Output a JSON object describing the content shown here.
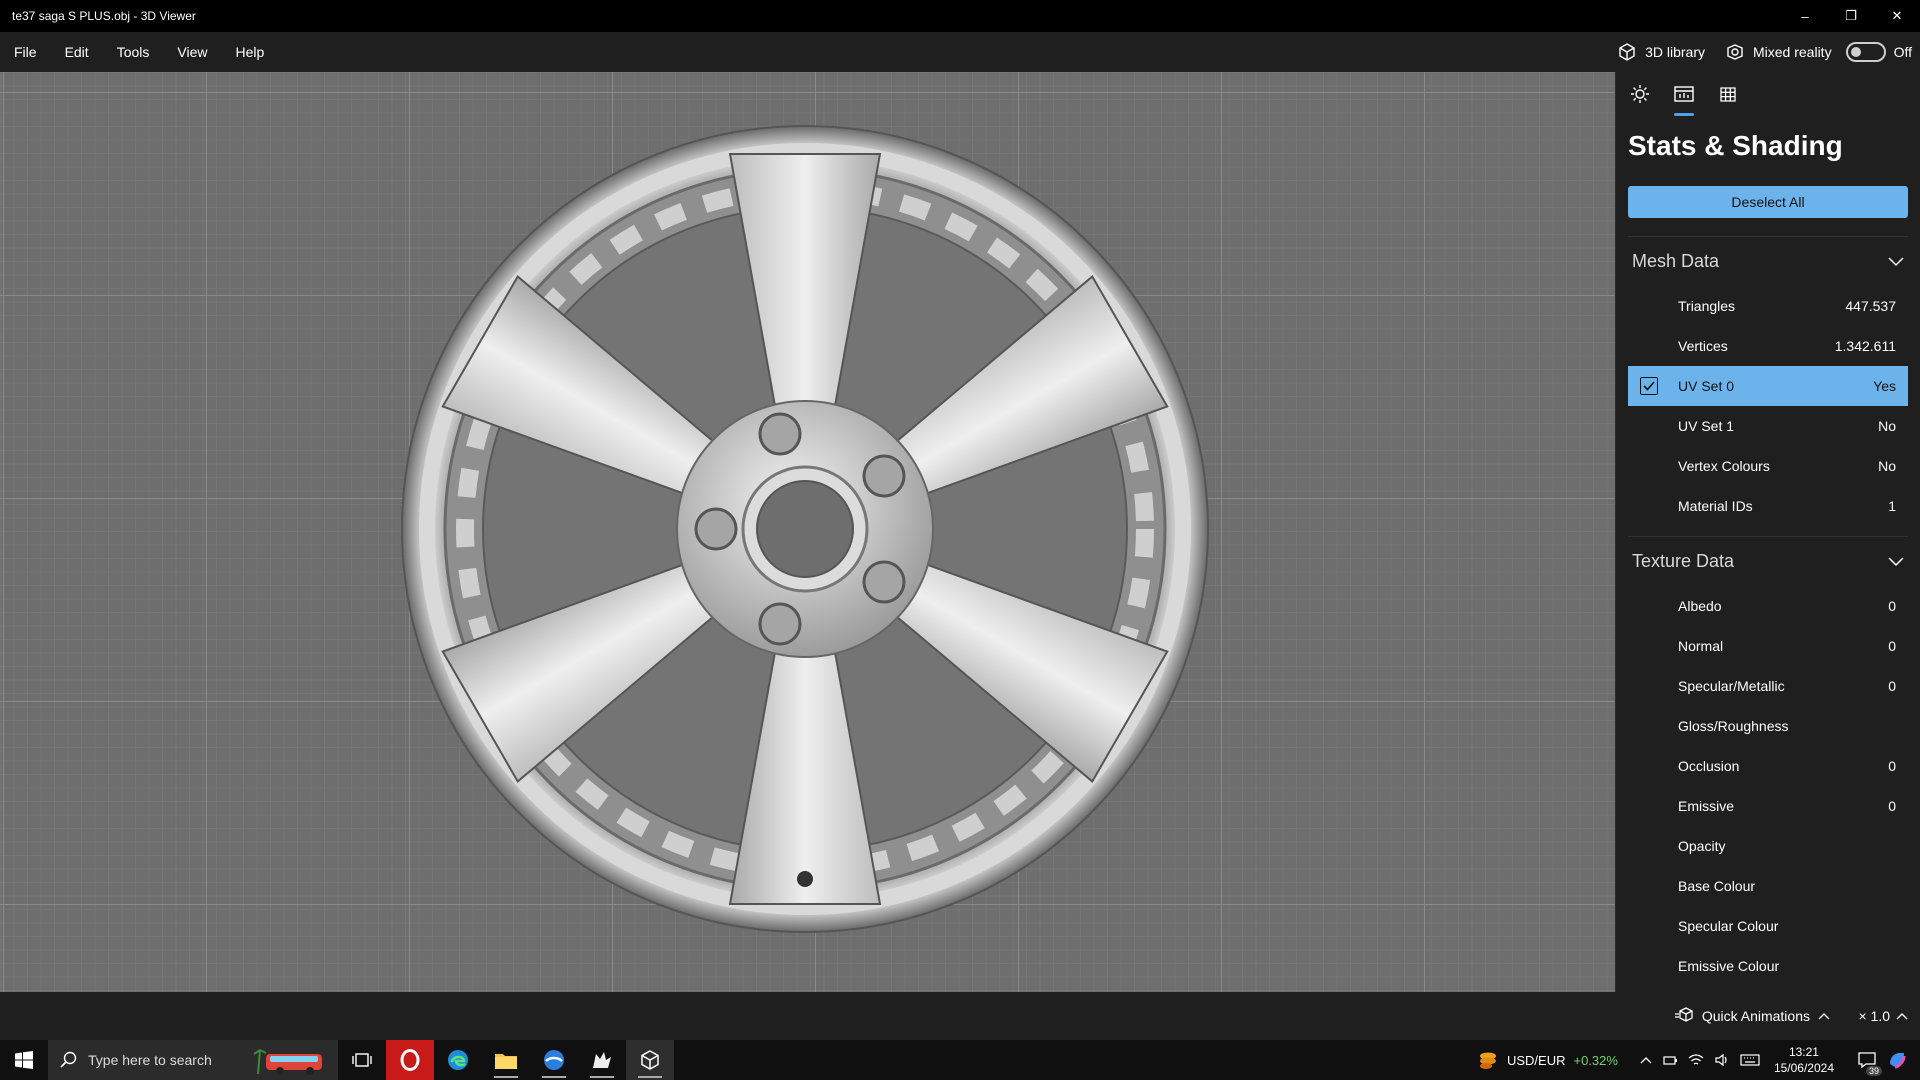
{
  "window": {
    "title": "te37 saga S PLUS.obj - 3D Viewer",
    "minimize": "–",
    "restore": "❐",
    "close": "✕"
  },
  "menu": {
    "items": [
      "File",
      "Edit",
      "Tools",
      "View",
      "Help"
    ],
    "library_label": "3D library",
    "mixed_reality_label": "Mixed reality",
    "mixed_reality_state": "Off"
  },
  "panel": {
    "tab_icons": [
      "sun-icon",
      "stats-icon",
      "grid-icon"
    ],
    "title": "Stats & Shading",
    "deselect_label": "Deselect All",
    "mesh": {
      "title": "Mesh Data",
      "rows": [
        {
          "label": "Triangles",
          "value": "447.537"
        },
        {
          "label": "Vertices",
          "value": "1.342.611"
        },
        {
          "label": "UV Set 0",
          "value": "Yes"
        },
        {
          "label": "UV Set 1",
          "value": "No"
        },
        {
          "label": "Vertex Colours",
          "value": "No"
        },
        {
          "label": "Material IDs",
          "value": "1"
        }
      ]
    },
    "texture": {
      "title": "Texture Data",
      "rows": [
        {
          "label": "Albedo",
          "value": "0"
        },
        {
          "label": "Normal",
          "value": "0"
        },
        {
          "label": "Specular/Metallic",
          "value": "0"
        },
        {
          "label": "Gloss/Roughness",
          "value": ""
        },
        {
          "label": "Occlusion",
          "value": "0"
        },
        {
          "label": "Emissive",
          "value": "0"
        },
        {
          "label": "Opacity",
          "value": ""
        },
        {
          "label": "Base Colour",
          "value": ""
        },
        {
          "label": "Specular Colour",
          "value": ""
        },
        {
          "label": "Emissive Colour",
          "value": ""
        }
      ]
    }
  },
  "bottom": {
    "quick_animations": "Quick Animations",
    "zoom": "× 1.0"
  },
  "taskbar": {
    "search_placeholder": "Type here to search",
    "fx_label": "USD/EUR",
    "fx_change": "+0.32%",
    "time": "13:21",
    "date": "15/06/2024",
    "notifications": "39"
  },
  "colors": {
    "accent": "#6cb3ec",
    "viewport_bg": "#6e6e6e",
    "fx_positive": "#6fd26f"
  }
}
